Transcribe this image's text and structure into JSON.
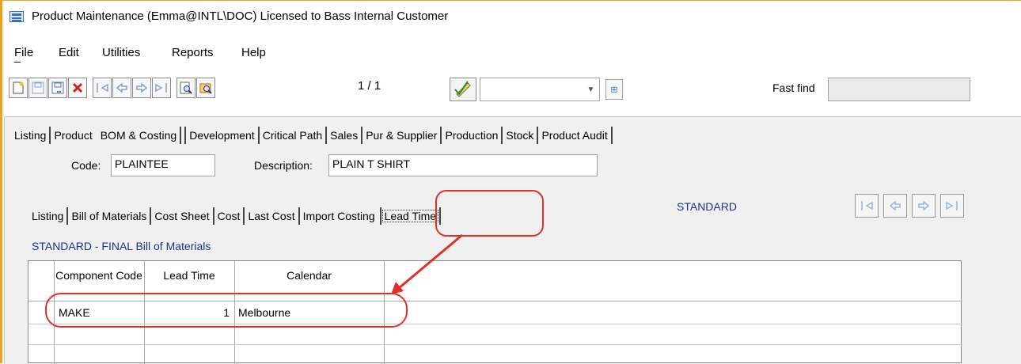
{
  "window": {
    "title": "Product Maintenance (Emma@INTL\\DOC) Licensed to Bass Internal Customer"
  },
  "menu": {
    "items": [
      "File",
      "Edit",
      "Utilities",
      "Reports",
      "Help"
    ]
  },
  "toolbar": {
    "buttons": [
      "new-record",
      "save",
      "save-as",
      "delete",
      "first-record",
      "previous-record",
      "next-record",
      "last-record",
      "preview",
      "search-records"
    ],
    "record_count": "1 / 1",
    "fast_find_label": "Fast find",
    "fast_find_value": ""
  },
  "tabs": {
    "main": [
      "Listing",
      "Product",
      "BOM & Costing",
      "Development",
      "Critical Path",
      "Sales",
      "Pur & Supplier",
      "Production",
      "Stock",
      "Product Audit"
    ],
    "active_main": "BOM & Costing",
    "sub": [
      "Listing",
      "Bill of Materials",
      "Cost Sheet",
      "Cost",
      "Last Cost",
      "Import Costing",
      "Lead Time"
    ],
    "active_sub": "Lead Time"
  },
  "product": {
    "code_label": "Code:",
    "code": "PLAINTEE",
    "description_label": "Description:",
    "description": "PLAIN T SHIRT"
  },
  "costing": {
    "standard_label": "STANDARD",
    "bom_title": "STANDARD - FINAL Bill of Materials"
  },
  "grid": {
    "headers": [
      "Component Code",
      "Lead Time",
      "Calendar"
    ],
    "rows": [
      {
        "component_code": "MAKE",
        "lead_time": "1",
        "calendar": "Melbourne"
      }
    ]
  },
  "colors": {
    "annotation": "#e0302a",
    "accent_text": "#1f2f8a",
    "window_border": "#f0a020"
  }
}
